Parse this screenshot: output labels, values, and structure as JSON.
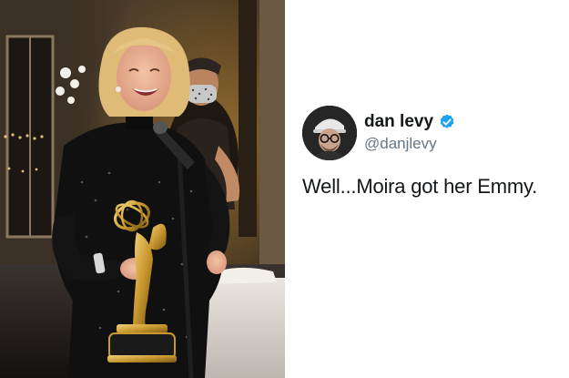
{
  "tweet": {
    "display_name": "dan levy",
    "handle": "@danjlevy",
    "text": "Well...Moira got her Emmy.",
    "verified": true,
    "verified_color": "#1da1f2"
  },
  "photo": {
    "subject_icon": "emmy-trophy-photo"
  },
  "icons": {
    "verified": "verified-badge-icon"
  }
}
